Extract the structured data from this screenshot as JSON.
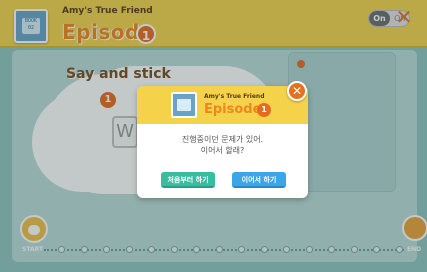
{
  "header": {
    "thumb_text_line1": "BOOK",
    "thumb_text_line2": "02",
    "series_title": "Amy's True Friend",
    "episode_label": "Episode",
    "episode_number": "1",
    "toggle": {
      "on_label": "On",
      "off_label": "Off"
    }
  },
  "activity": {
    "title": "Say and stick",
    "item_number": "1",
    "letter_hint": "W"
  },
  "progress": {
    "start_label": "START",
    "end_label": "END"
  },
  "dialog": {
    "series_title": "Amy's True Friend",
    "episode_label": "Episode",
    "episode_number": "1",
    "message_line1": "진행중이던 문제가 있어.",
    "message_line2": "이어서 할래?",
    "restart_label": "처음부터 하기",
    "continue_label": "이어서 하기",
    "close_glyph": "✕"
  },
  "colors": {
    "header_bg": "#f4d24a",
    "accent_orange": "#e76b1f",
    "restart_btn": "#39bda0",
    "continue_btn": "#3aa6e8"
  }
}
